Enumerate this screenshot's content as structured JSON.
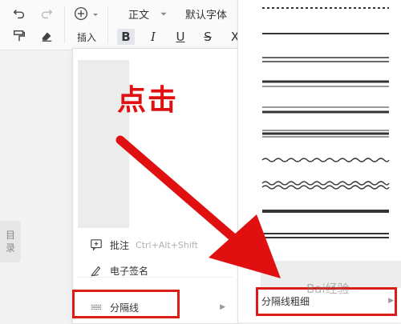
{
  "toolbar": {
    "insert_label": "插入",
    "style_value": "正文",
    "font_value": "默认字体",
    "format_buttons": [
      "B",
      "I",
      "U",
      "S",
      "X"
    ]
  },
  "left_panel": {
    "tab_label_1": "目",
    "tab_label_2": "录"
  },
  "menu": {
    "annotate_label": "批注",
    "annotate_shortcut": "Ctrl+Alt+Shift",
    "signature_label": "电子签名",
    "divider_label": "分隔线"
  },
  "submenu": {
    "line_styles": [
      "dotted",
      "thin",
      "double",
      "thick-thin",
      "thin-thick",
      "triple",
      "wavy",
      "double-wavy",
      "thick",
      "dashed-dots"
    ],
    "weight_label": "分隔线粗细"
  },
  "overlay": {
    "callout_text": "点击",
    "watermark": "Bai经验",
    "accent_color": "#e01010"
  }
}
